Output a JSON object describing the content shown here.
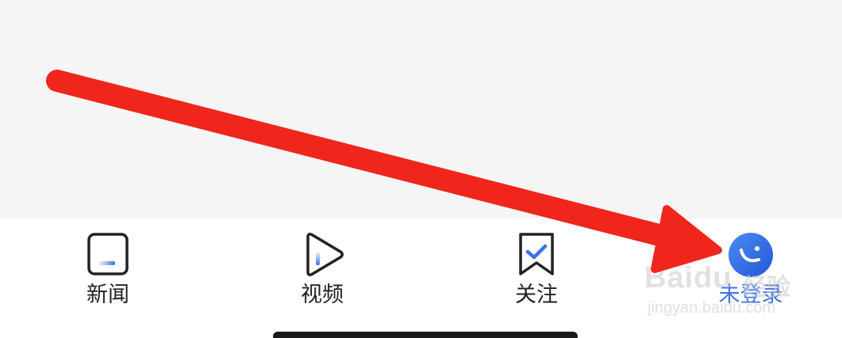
{
  "tabbar": {
    "tabs": [
      {
        "label": "新闻",
        "icon": "news-icon",
        "active": false
      },
      {
        "label": "视频",
        "icon": "play-icon",
        "active": false
      },
      {
        "label": "关注",
        "icon": "bookmark-check-icon",
        "active": false
      },
      {
        "label": "未登录",
        "icon": "avatar-icon",
        "active": true
      }
    ]
  },
  "watermark": {
    "brand": "Baidu",
    "sub": "经验",
    "url": "jingyan.baidu.com"
  },
  "colors": {
    "accent": "#3b73e6",
    "annotation_arrow": "#f0261c",
    "content_bg": "#f5f5f5",
    "label_text": "#222222"
  }
}
